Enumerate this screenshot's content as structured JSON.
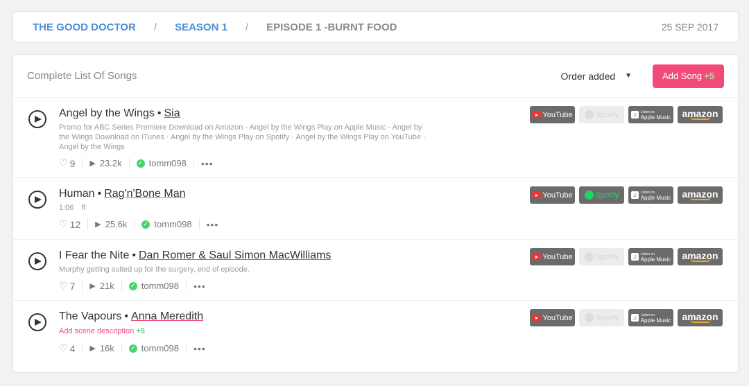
{
  "breadcrumb": {
    "show": "THE GOOD DOCTOR",
    "separator": "/",
    "season": "SEASON 1",
    "episode": "EPISODE 1 -BURNT FOOD",
    "date": "25 SEP 2017"
  },
  "panel": {
    "title": "Complete List Of Songs",
    "order_label": "Order added",
    "add_song_label": "Add Song",
    "add_song_points": "+5"
  },
  "colors": {
    "accent_blue": "#4a90d6",
    "accent_pink": "#f24b7a",
    "green": "#4cd26b",
    "service_active": "#6b6b6b"
  },
  "services": {
    "youtube": "YouTube",
    "spotify": "Spotify",
    "apple_small": "Listen on",
    "apple": "Apple Music",
    "amazon": "amazon"
  },
  "songs": [
    {
      "title": "Angel by the Wings",
      "artist": "Sia",
      "description": "Promo for ABC Series Premiere Download on Amazon · Angel by the Wings Play on Apple Music · Angel by the Wings Download on iTunes · Angel by the Wings Play on Spotify · Angel by the Wings Play on YouTube · Angel by the Wings",
      "likes": "9",
      "plays": "23.2k",
      "user": "tomm098",
      "spotify_available": false
    },
    {
      "title": "Human",
      "artist": "Rag'n'Bone Man",
      "timestamp": "1:06",
      "tag": "ff",
      "likes": "12",
      "plays": "25.6k",
      "user": "tomm098",
      "spotify_available": true
    },
    {
      "title": "I Fear the Nite",
      "artist": "Dan Romer & Saul Simon MacWilliams",
      "description": "Murphy getting suited up for the surgery, end of episode.",
      "likes": "7",
      "plays": "21k",
      "user": "tomm098",
      "spotify_available": false
    },
    {
      "title": "The Vapours",
      "artist": "Anna Meredith",
      "add_description_label": "Add scene description",
      "add_description_points": "+5",
      "likes": "4",
      "plays": "16k",
      "user": "tomm098",
      "spotify_available": false
    }
  ]
}
